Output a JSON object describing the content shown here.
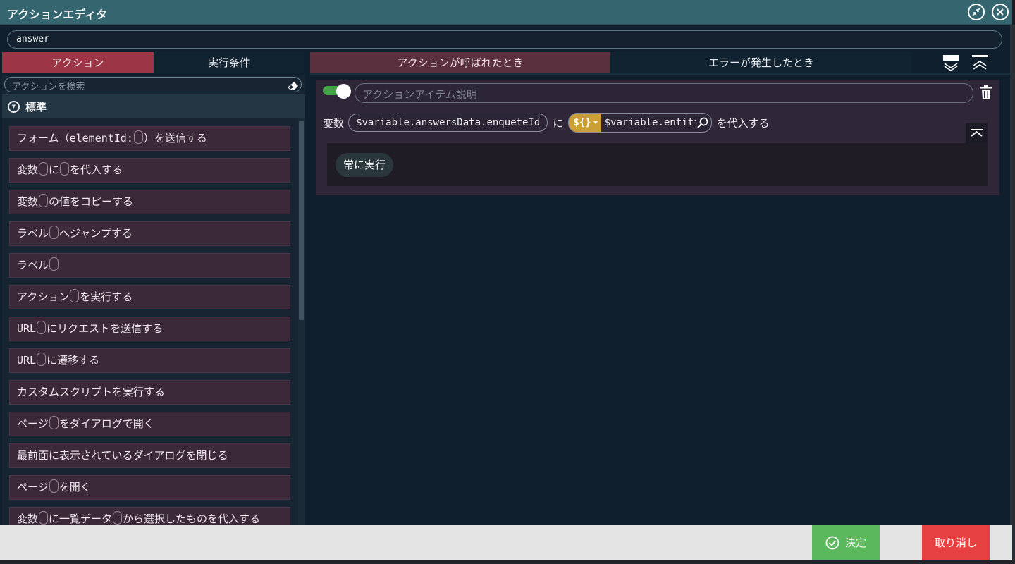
{
  "window": {
    "title": "アクションエディタ",
    "name_value": "answer"
  },
  "left_tabs": [
    {
      "label": "アクション",
      "active": true
    },
    {
      "label": "実行条件",
      "active": false
    }
  ],
  "right_tabs": [
    {
      "label": "アクションが呼ばれたとき",
      "active": true
    },
    {
      "label": "エラーが発生したとき",
      "active": false
    }
  ],
  "action_search": {
    "placeholder": "アクションを検索",
    "value": ""
  },
  "category": {
    "label": "標準",
    "icon": "chevron-down-circle-icon"
  },
  "action_items": [
    {
      "parts": [
        "フォーム（",
        "elementId:",
        "slot",
        "）を送信する"
      ]
    },
    {
      "parts": [
        "変数",
        "slot",
        "に",
        "slot",
        "を代入する"
      ]
    },
    {
      "parts": [
        "変数",
        "slot",
        "の値をコピーする"
      ]
    },
    {
      "parts": [
        "ラベル",
        "slot",
        "へジャンプする"
      ]
    },
    {
      "parts": [
        "ラベル",
        "slot"
      ]
    },
    {
      "parts": [
        "アクション",
        "slot",
        "を実行する"
      ]
    },
    {
      "parts": [
        "URL",
        "slot",
        "にリクエストを送信する"
      ]
    },
    {
      "parts": [
        "URL",
        "slot",
        "に遷移する"
      ]
    },
    {
      "parts": [
        "カスタムスクリプトを実行する"
      ]
    },
    {
      "parts": [
        "ページ",
        "slot",
        "をダイアログで開く"
      ]
    },
    {
      "parts": [
        "最前面に表示されているダイアログを閉じる"
      ]
    },
    {
      "parts": [
        "ページ",
        "slot",
        "を開く"
      ]
    },
    {
      "parts": [
        "変数",
        "slot",
        "に一覧データ",
        "slot",
        "から選択したものを代入する"
      ]
    }
  ],
  "action_card": {
    "enabled": true,
    "description_placeholder": "アクションアイテム説明",
    "description_value": "",
    "label_variable": "変数",
    "variable_value": "$variable.answersData.enqueteId",
    "label_ni": "に",
    "value_prefix": "${}",
    "value_text": "$variable.entities.enqueteId",
    "label_assign": "を代入する",
    "condition_label": "常に実行"
  },
  "footer": {
    "ok_label": "決定",
    "cancel_label": "取り消し"
  },
  "colors": {
    "titlebar": "#35656f",
    "active_tab": "#9c3546",
    "ok": "#5cb85c",
    "cancel": "#e74040",
    "prefix": "#caa036",
    "toggle_on": "#45a14a"
  }
}
